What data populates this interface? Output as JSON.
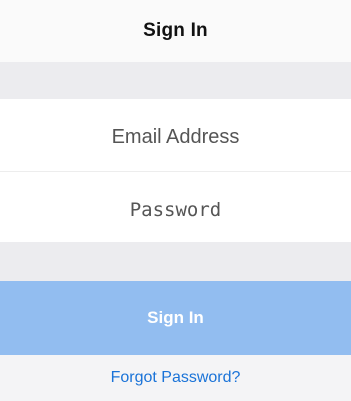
{
  "header": {
    "title": "Sign In"
  },
  "form": {
    "email": {
      "value": "",
      "placeholder": "Email Address"
    },
    "password": {
      "value": "",
      "placeholder": "Password"
    },
    "submit_label": "Sign In",
    "forgot_label": "Forgot Password?"
  },
  "colors": {
    "accent": "#92bdf0",
    "link": "#1a73d8",
    "background": "#f4f4f6"
  }
}
